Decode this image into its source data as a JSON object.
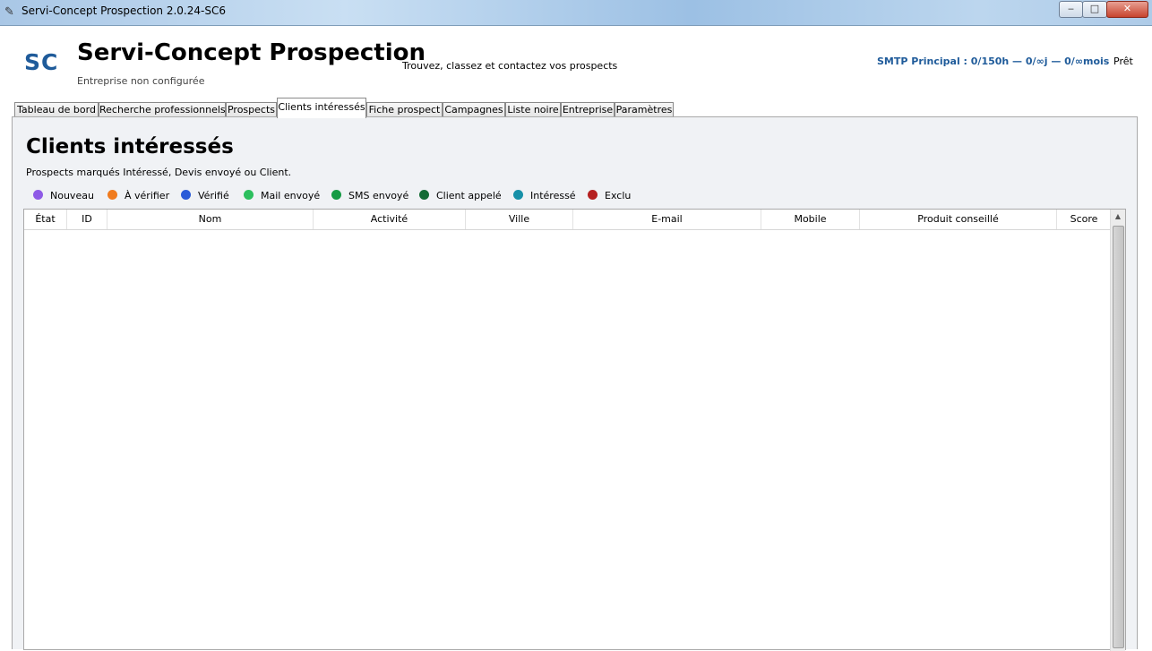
{
  "window": {
    "title": "Servi-Concept Prospection 2.0.24-SC6",
    "app_icon": "feather-icon",
    "controls": {
      "minimize": "‒",
      "maximize": "□",
      "close": "✕"
    }
  },
  "header": {
    "logo": "SC",
    "app_name": "Servi-Concept Prospection",
    "company_status": "Entreprise non configurée",
    "tagline": "Trouvez, classez et contactez vos prospects",
    "smtp_status": "SMTP Principal : 0/150h — 0/∞j — 0/∞mois",
    "status": "Prêt"
  },
  "tabs": [
    {
      "label": "Tableau de bord",
      "active": false
    },
    {
      "label": "Recherche professionnels",
      "active": false
    },
    {
      "label": "Prospects",
      "active": false
    },
    {
      "label": "Clients intéressés",
      "active": true
    },
    {
      "label": "Fiche prospect",
      "active": false
    },
    {
      "label": "Campagnes",
      "active": false
    },
    {
      "label": "Liste noire",
      "active": false
    },
    {
      "label": "Entreprise",
      "active": false
    },
    {
      "label": "Paramètres",
      "active": false
    }
  ],
  "page": {
    "title": "Clients intéressés",
    "subtitle": "Prospects marqués Intéressé, Devis envoyé ou Client."
  },
  "legend": [
    {
      "label": "Nouveau",
      "color": "#8e5ae6"
    },
    {
      "label": "À vérifier",
      "color": "#f07b1e"
    },
    {
      "label": "Vérifié",
      "color": "#2a5bd8"
    },
    {
      "label": "Mail envoyé",
      "color": "#2cbf5e"
    },
    {
      "label": "SMS envoyé",
      "color": "#169b45"
    },
    {
      "label": "Client appelé",
      "color": "#136b35"
    },
    {
      "label": "Intéressé",
      "color": "#1690a8"
    },
    {
      "label": "Exclu",
      "color": "#b52020"
    }
  ],
  "table": {
    "columns": [
      "État",
      "ID",
      "Nom",
      "Activité",
      "Ville",
      "E-mail",
      "Mobile",
      "Produit conseillé",
      "Score"
    ],
    "rows": []
  }
}
